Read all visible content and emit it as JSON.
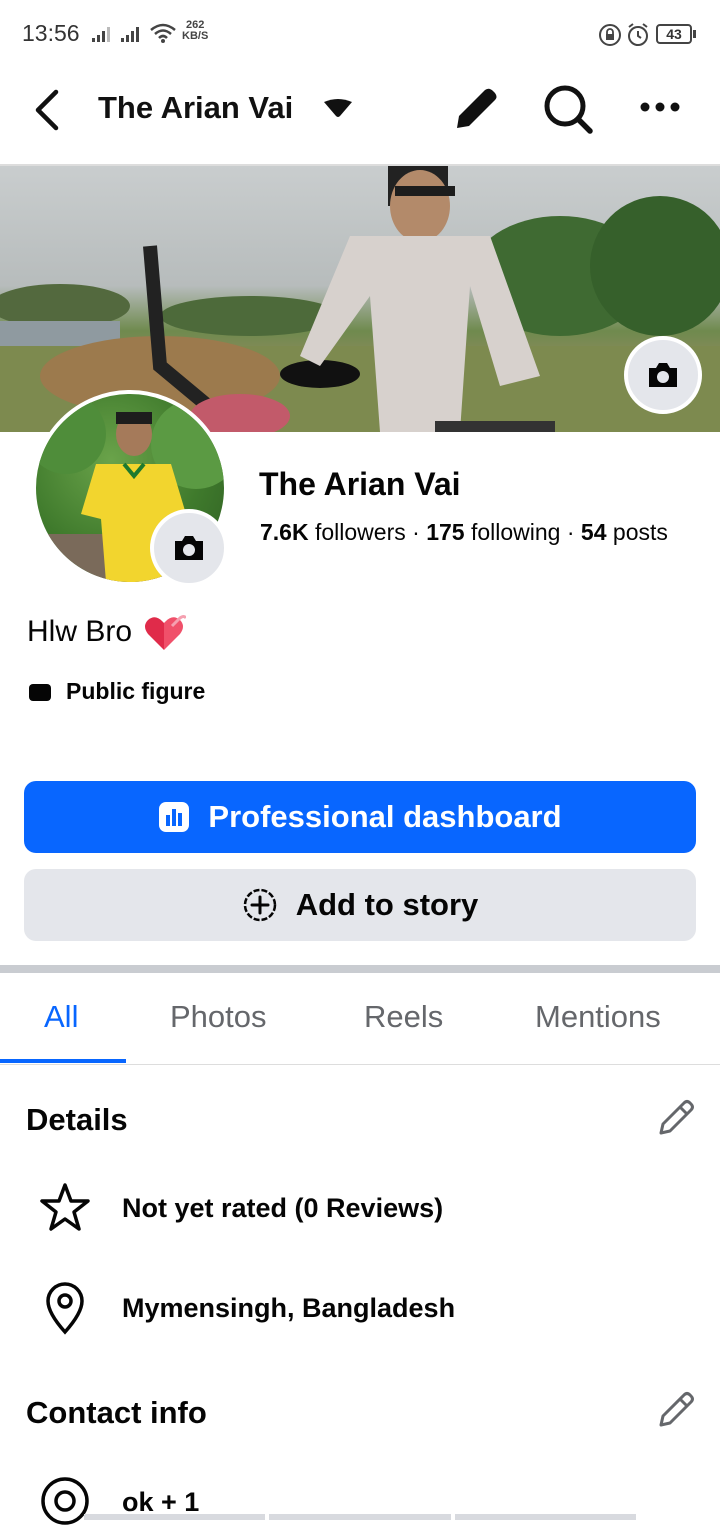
{
  "status_bar": {
    "time": "13:56",
    "net_speed_value": "262",
    "net_speed_unit": "KB/S",
    "battery": "43"
  },
  "header": {
    "title": "The Arian Vai",
    "icons": [
      "back-arrow-icon",
      "dropdown-caret-icon",
      "pencil-icon",
      "search-icon",
      "more-icon"
    ]
  },
  "profile": {
    "name": "The Arian Vai",
    "followers_count": "7.6K",
    "followers_label": "followers",
    "following_count": "175",
    "following_label": "following",
    "posts_count": "54",
    "posts_label": "posts",
    "separator": "·",
    "bio": "Hlw Bro",
    "category": "Public figure"
  },
  "buttons": {
    "dashboard": "Professional dashboard",
    "add_story": "Add to story"
  },
  "tabs": [
    "All",
    "Photos",
    "Reels",
    "Mentions"
  ],
  "active_tab": "All",
  "details": {
    "title": "Details",
    "rating": "Not yet rated (0 Reviews)",
    "location": "Mymensingh, Bangladesh"
  },
  "contact": {
    "title": "Contact info",
    "item": "ok + 1"
  },
  "colors": {
    "accent": "#0866ff",
    "secondary_button": "#e4e6eb",
    "muted_text": "#65676b"
  }
}
